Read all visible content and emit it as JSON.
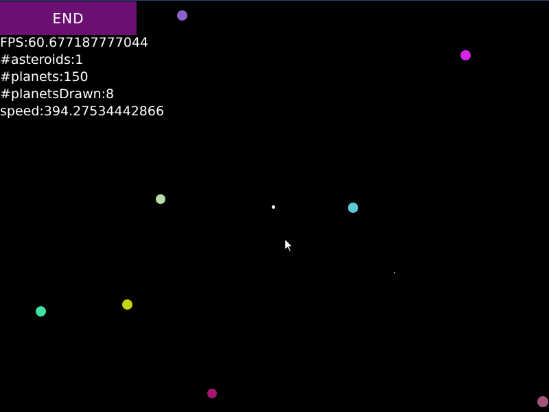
{
  "end_button": {
    "label": "END"
  },
  "hud": {
    "fps": "FPS:60.677187777044",
    "asteroids": "#asteroids:1",
    "planets": "#planets:150",
    "planets_drawn": "#planetsDrawn:8",
    "speed": "speed:394.27534442866"
  },
  "colors": {
    "background": "#000000",
    "end_button_bg": "#6b0f73",
    "text": "#ffffff",
    "planets": [
      "#8a62cc",
      "#d425e6",
      "#b7ddaa",
      "#5fc8d9",
      "#3fe0a2",
      "#c2d40c",
      "#a3176e",
      "#a5537a"
    ],
    "asteroid": "#ffffff",
    "dust": "#9a9a9a"
  },
  "icons": {
    "cursor": "mouse-pointer-icon"
  }
}
